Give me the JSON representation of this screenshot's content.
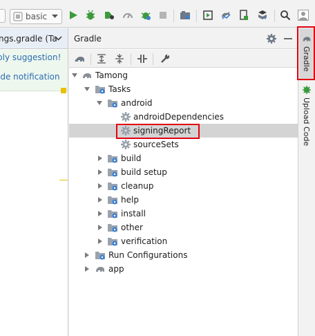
{
  "toolbar": {
    "run_config": "basic",
    "buttons": [
      "run-icon",
      "debug-icon",
      "profile-icon",
      "attach-debugger-icon",
      "apply-changes-icon",
      "stop-icon",
      "sdk-manager-icon",
      "avd-manager-icon",
      "sync-gradle-icon",
      "device-file-icon",
      "layout-inspector-icon",
      "search-icon",
      "user-icon"
    ]
  },
  "editor": {
    "tab_label": "ngs.gradle (Ta",
    "suggestion_link": "ply suggestion!",
    "hide_link": "ide notification"
  },
  "gradle_panel": {
    "title": "Gradle",
    "tree": [
      {
        "label": "Tamong",
        "type": "project",
        "expanded": true
      },
      {
        "label": "Tasks",
        "type": "folder",
        "expanded": true
      },
      {
        "label": "android",
        "type": "folder",
        "expanded": true
      },
      {
        "label": "androidDependencies",
        "type": "task"
      },
      {
        "label": "signingReport",
        "type": "task",
        "selected": true
      },
      {
        "label": "sourceSets",
        "type": "task"
      },
      {
        "label": "build",
        "type": "folder",
        "expanded": false
      },
      {
        "label": "build setup",
        "type": "folder",
        "expanded": false
      },
      {
        "label": "cleanup",
        "type": "folder",
        "expanded": false
      },
      {
        "label": "help",
        "type": "folder",
        "expanded": false
      },
      {
        "label": "install",
        "type": "folder",
        "expanded": false
      },
      {
        "label": "other",
        "type": "folder",
        "expanded": false
      },
      {
        "label": "verification",
        "type": "folder",
        "expanded": false
      },
      {
        "label": "Run Configurations",
        "type": "run-folder",
        "expanded": false
      },
      {
        "label": "app",
        "type": "project",
        "expanded": false
      }
    ]
  },
  "right_strip": {
    "gradle_tab": "Gradle",
    "upload_tab": "Upload Code"
  },
  "colors": {
    "highlight": "#e3000f",
    "selection": "#d4d4d4",
    "link": "#2b6cb0"
  }
}
